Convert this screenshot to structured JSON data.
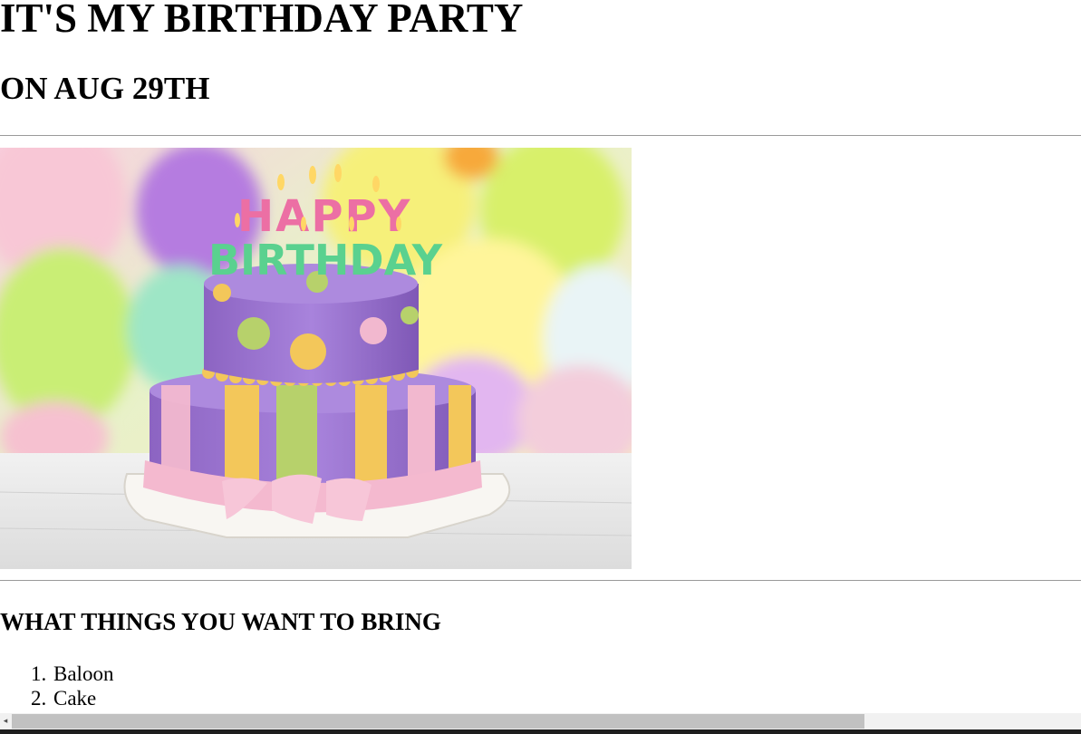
{
  "page": {
    "title": "IT'S MY BIRTHDAY PARTY",
    "date": "ON AUG 29TH",
    "list_heading": "WHAT THINGS YOU WANT TO BRING",
    "items": [
      {
        "num": "1.",
        "label": "Baloon"
      },
      {
        "num": "2.",
        "label": "Cake"
      }
    ]
  },
  "image": {
    "cake_top_word": "HAPPY",
    "cake_bottom_word": "BIRTHDAY"
  },
  "colors": {
    "cake_purple": "#a17ad1",
    "frosting_pink": "#f2b8cf",
    "stripe_yellow": "#f3c75a",
    "stripe_green": "#b7d16b"
  }
}
